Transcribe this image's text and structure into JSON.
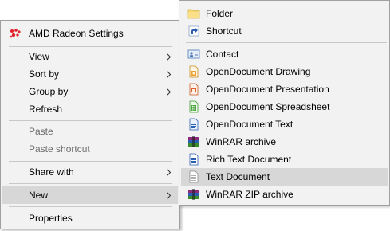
{
  "context_menu": {
    "amd_label": "AMD Radeon Settings",
    "view_label": "View",
    "sort_by_label": "Sort by",
    "group_by_label": "Group by",
    "refresh_label": "Refresh",
    "paste_label": "Paste",
    "paste_shortcut_label": "Paste shortcut",
    "share_with_label": "Share with",
    "new_label": "New",
    "properties_label": "Properties"
  },
  "new_submenu": {
    "folder_label": "Folder",
    "shortcut_label": "Shortcut",
    "contact_label": "Contact",
    "od_drawing_label": "OpenDocument Drawing",
    "od_presentation_label": "OpenDocument Presentation",
    "od_spreadsheet_label": "OpenDocument Spreadsheet",
    "od_text_label": "OpenDocument Text",
    "winrar_archive_label": "WinRAR archive",
    "rich_text_label": "Rich Text Document",
    "text_document_label": "Text Document",
    "winrar_zip_label": "WinRAR ZIP archive"
  },
  "colors": {
    "menu_bg": "#f2f2f2",
    "highlight": "#d7d7d7",
    "disabled_text": "#6d6d6d",
    "amd_red": "#e0202a"
  }
}
